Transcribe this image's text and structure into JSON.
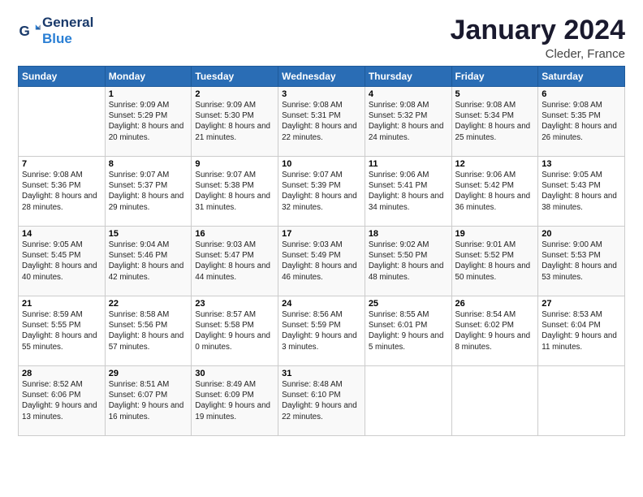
{
  "logo": {
    "line1": "General",
    "line2": "Blue"
  },
  "title": "January 2024",
  "subtitle": "Cleder, France",
  "days_of_week": [
    "Sunday",
    "Monday",
    "Tuesday",
    "Wednesday",
    "Thursday",
    "Friday",
    "Saturday"
  ],
  "weeks": [
    [
      {
        "day": "",
        "sunrise": "",
        "sunset": "",
        "daylight": ""
      },
      {
        "day": "1",
        "sunrise": "Sunrise: 9:09 AM",
        "sunset": "Sunset: 5:29 PM",
        "daylight": "Daylight: 8 hours and 20 minutes."
      },
      {
        "day": "2",
        "sunrise": "Sunrise: 9:09 AM",
        "sunset": "Sunset: 5:30 PM",
        "daylight": "Daylight: 8 hours and 21 minutes."
      },
      {
        "day": "3",
        "sunrise": "Sunrise: 9:08 AM",
        "sunset": "Sunset: 5:31 PM",
        "daylight": "Daylight: 8 hours and 22 minutes."
      },
      {
        "day": "4",
        "sunrise": "Sunrise: 9:08 AM",
        "sunset": "Sunset: 5:32 PM",
        "daylight": "Daylight: 8 hours and 24 minutes."
      },
      {
        "day": "5",
        "sunrise": "Sunrise: 9:08 AM",
        "sunset": "Sunset: 5:34 PM",
        "daylight": "Daylight: 8 hours and 25 minutes."
      },
      {
        "day": "6",
        "sunrise": "Sunrise: 9:08 AM",
        "sunset": "Sunset: 5:35 PM",
        "daylight": "Daylight: 8 hours and 26 minutes."
      }
    ],
    [
      {
        "day": "7",
        "sunrise": "Sunrise: 9:08 AM",
        "sunset": "Sunset: 5:36 PM",
        "daylight": "Daylight: 8 hours and 28 minutes."
      },
      {
        "day": "8",
        "sunrise": "Sunrise: 9:07 AM",
        "sunset": "Sunset: 5:37 PM",
        "daylight": "Daylight: 8 hours and 29 minutes."
      },
      {
        "day": "9",
        "sunrise": "Sunrise: 9:07 AM",
        "sunset": "Sunset: 5:38 PM",
        "daylight": "Daylight: 8 hours and 31 minutes."
      },
      {
        "day": "10",
        "sunrise": "Sunrise: 9:07 AM",
        "sunset": "Sunset: 5:39 PM",
        "daylight": "Daylight: 8 hours and 32 minutes."
      },
      {
        "day": "11",
        "sunrise": "Sunrise: 9:06 AM",
        "sunset": "Sunset: 5:41 PM",
        "daylight": "Daylight: 8 hours and 34 minutes."
      },
      {
        "day": "12",
        "sunrise": "Sunrise: 9:06 AM",
        "sunset": "Sunset: 5:42 PM",
        "daylight": "Daylight: 8 hours and 36 minutes."
      },
      {
        "day": "13",
        "sunrise": "Sunrise: 9:05 AM",
        "sunset": "Sunset: 5:43 PM",
        "daylight": "Daylight: 8 hours and 38 minutes."
      }
    ],
    [
      {
        "day": "14",
        "sunrise": "Sunrise: 9:05 AM",
        "sunset": "Sunset: 5:45 PM",
        "daylight": "Daylight: 8 hours and 40 minutes."
      },
      {
        "day": "15",
        "sunrise": "Sunrise: 9:04 AM",
        "sunset": "Sunset: 5:46 PM",
        "daylight": "Daylight: 8 hours and 42 minutes."
      },
      {
        "day": "16",
        "sunrise": "Sunrise: 9:03 AM",
        "sunset": "Sunset: 5:47 PM",
        "daylight": "Daylight: 8 hours and 44 minutes."
      },
      {
        "day": "17",
        "sunrise": "Sunrise: 9:03 AM",
        "sunset": "Sunset: 5:49 PM",
        "daylight": "Daylight: 8 hours and 46 minutes."
      },
      {
        "day": "18",
        "sunrise": "Sunrise: 9:02 AM",
        "sunset": "Sunset: 5:50 PM",
        "daylight": "Daylight: 8 hours and 48 minutes."
      },
      {
        "day": "19",
        "sunrise": "Sunrise: 9:01 AM",
        "sunset": "Sunset: 5:52 PM",
        "daylight": "Daylight: 8 hours and 50 minutes."
      },
      {
        "day": "20",
        "sunrise": "Sunrise: 9:00 AM",
        "sunset": "Sunset: 5:53 PM",
        "daylight": "Daylight: 8 hours and 53 minutes."
      }
    ],
    [
      {
        "day": "21",
        "sunrise": "Sunrise: 8:59 AM",
        "sunset": "Sunset: 5:55 PM",
        "daylight": "Daylight: 8 hours and 55 minutes."
      },
      {
        "day": "22",
        "sunrise": "Sunrise: 8:58 AM",
        "sunset": "Sunset: 5:56 PM",
        "daylight": "Daylight: 8 hours and 57 minutes."
      },
      {
        "day": "23",
        "sunrise": "Sunrise: 8:57 AM",
        "sunset": "Sunset: 5:58 PM",
        "daylight": "Daylight: 9 hours and 0 minutes."
      },
      {
        "day": "24",
        "sunrise": "Sunrise: 8:56 AM",
        "sunset": "Sunset: 5:59 PM",
        "daylight": "Daylight: 9 hours and 3 minutes."
      },
      {
        "day": "25",
        "sunrise": "Sunrise: 8:55 AM",
        "sunset": "Sunset: 6:01 PM",
        "daylight": "Daylight: 9 hours and 5 minutes."
      },
      {
        "day": "26",
        "sunrise": "Sunrise: 8:54 AM",
        "sunset": "Sunset: 6:02 PM",
        "daylight": "Daylight: 9 hours and 8 minutes."
      },
      {
        "day": "27",
        "sunrise": "Sunrise: 8:53 AM",
        "sunset": "Sunset: 6:04 PM",
        "daylight": "Daylight: 9 hours and 11 minutes."
      }
    ],
    [
      {
        "day": "28",
        "sunrise": "Sunrise: 8:52 AM",
        "sunset": "Sunset: 6:06 PM",
        "daylight": "Daylight: 9 hours and 13 minutes."
      },
      {
        "day": "29",
        "sunrise": "Sunrise: 8:51 AM",
        "sunset": "Sunset: 6:07 PM",
        "daylight": "Daylight: 9 hours and 16 minutes."
      },
      {
        "day": "30",
        "sunrise": "Sunrise: 8:49 AM",
        "sunset": "Sunset: 6:09 PM",
        "daylight": "Daylight: 9 hours and 19 minutes."
      },
      {
        "day": "31",
        "sunrise": "Sunrise: 8:48 AM",
        "sunset": "Sunset: 6:10 PM",
        "daylight": "Daylight: 9 hours and 22 minutes."
      },
      {
        "day": "",
        "sunrise": "",
        "sunset": "",
        "daylight": ""
      },
      {
        "day": "",
        "sunrise": "",
        "sunset": "",
        "daylight": ""
      },
      {
        "day": "",
        "sunrise": "",
        "sunset": "",
        "daylight": ""
      }
    ]
  ]
}
